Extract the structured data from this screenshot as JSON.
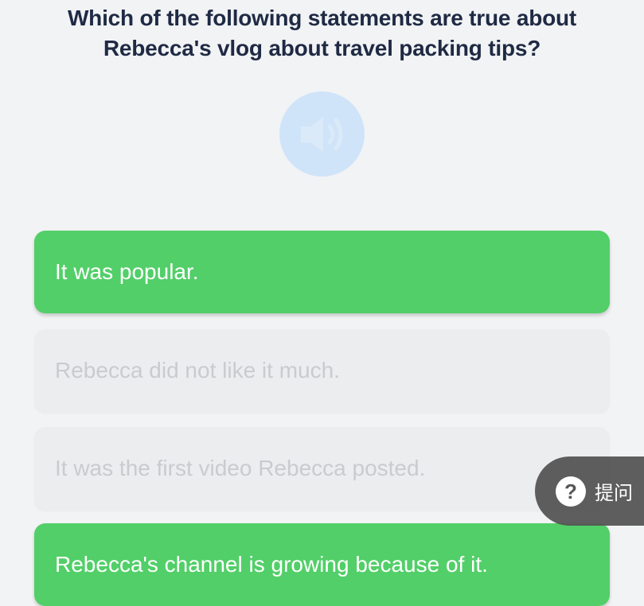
{
  "question": {
    "line1": "Which of the following statements are true about",
    "line2": "Rebecca's vlog about travel packing tips?"
  },
  "audio": {
    "icon": "speaker-icon",
    "color": "#cfe4f8"
  },
  "options": [
    {
      "label": "It was popular.",
      "state": "correct"
    },
    {
      "label": "Rebecca did not like it much.",
      "state": "disabled"
    },
    {
      "label": "It was the first video Rebecca posted.",
      "state": "disabled"
    },
    {
      "label": "Rebecca's channel is growing because of it.",
      "state": "correct"
    }
  ],
  "help": {
    "icon_glyph": "?",
    "label": "提问"
  },
  "colors": {
    "correct": "#52cf68",
    "disabled_bg": "#ecedef",
    "disabled_text": "#c9cbcf",
    "question_text": "#1f2a44",
    "background": "#f2f3f5"
  }
}
